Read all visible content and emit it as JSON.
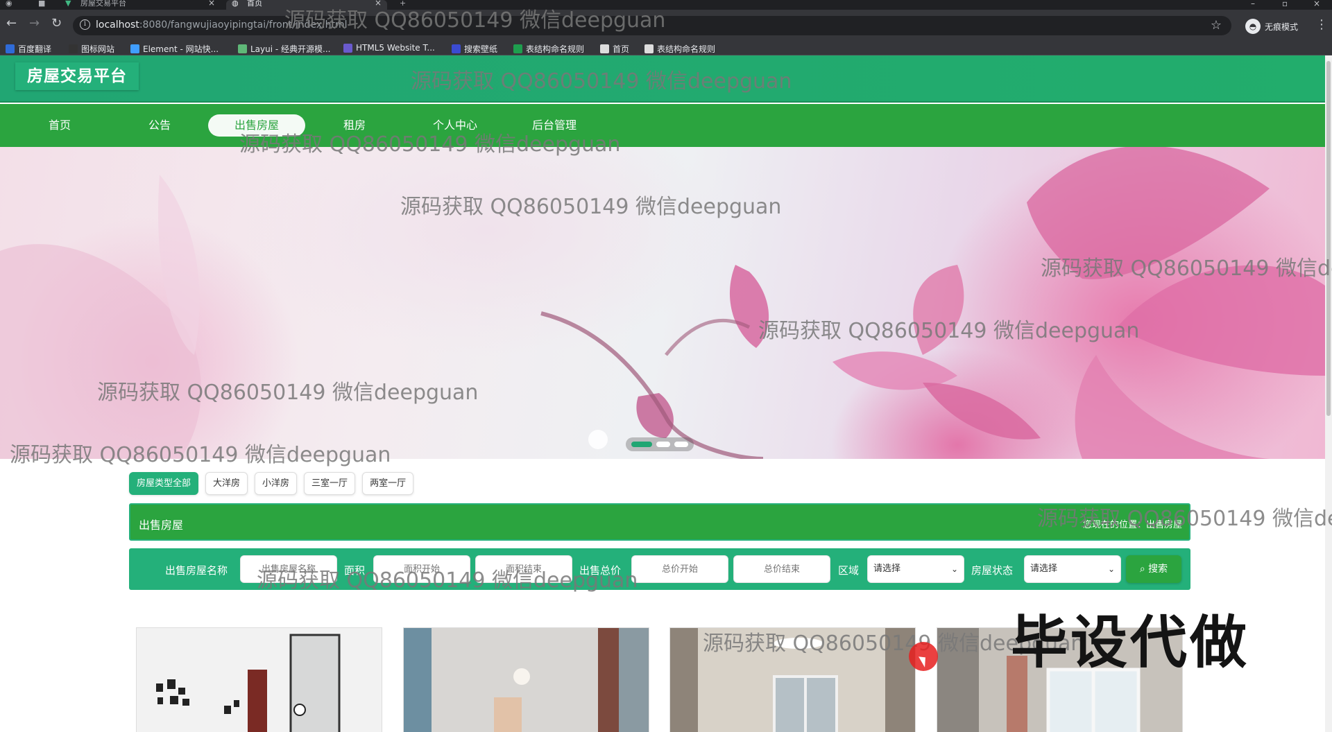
{
  "browser": {
    "tabs": [
      {
        "label": "房屋交易平台"
      },
      {
        "label": "首页"
      }
    ],
    "new_tab_glyph": "+",
    "address": {
      "host": "localhost",
      "path": ":8080/fangwujiaoyipingtai/front/index.html"
    },
    "incognito_label": "无痕模式",
    "bookmarks": [
      {
        "label": "百度翻译",
        "icon": "translate-icon",
        "color": "#2f6bd8"
      },
      {
        "label": "图标网站",
        "icon": "flag-icon",
        "color": "#333333"
      },
      {
        "label": "Element - 网站快...",
        "icon": "element-icon",
        "color": "#409eff"
      },
      {
        "label": "Layui - 经典开源模...",
        "icon": "layui-icon",
        "color": "#5fb878"
      },
      {
        "label": "HTML5 Website T...",
        "icon": "html5-icon",
        "color": "#6a5acd"
      },
      {
        "label": "搜索壁纸",
        "icon": "wallpaper-icon",
        "color": "#3b4bd1"
      },
      {
        "label": "表结构命名规则",
        "icon": "sheet-icon",
        "color": "#1e9e4e"
      },
      {
        "label": "首页",
        "icon": "globe-icon",
        "color": "#dddddd"
      },
      {
        "label": "表结构命名规则",
        "icon": "globe-icon",
        "color": "#dddddd"
      }
    ]
  },
  "site": {
    "logo": "房屋交易平台",
    "nav": [
      {
        "label": "首页"
      },
      {
        "label": "公告"
      },
      {
        "label": "出售房屋",
        "active": true
      },
      {
        "label": "租房"
      },
      {
        "label": "个人中心"
      },
      {
        "label": "后台管理"
      }
    ],
    "banner": {
      "slides": 3,
      "active_slide": 1
    },
    "type_filter": [
      "房屋类型全部",
      "大洋房",
      "小洋房",
      "三室一厅",
      "两室一厅"
    ],
    "section": {
      "title": "出售房屋",
      "breadcrumb": "您现在的位置：出售房屋"
    },
    "search": {
      "name_label": "出售房屋名称",
      "name_placeholder": "出售房屋名称",
      "area_label": "面积",
      "area_start_placeholder": "面积开始",
      "area_end_placeholder": "面积结束",
      "price_label": "出售总价",
      "price_start_placeholder": "总价开始",
      "price_end_placeholder": "总价结束",
      "region_label": "区域",
      "region_value": "请选择",
      "status_label": "房屋状态",
      "status_value": "请选择",
      "button_label": "搜索"
    }
  },
  "overlays": {
    "watermark": "源码获取 QQ86050149 微信deepguan",
    "promo": "毕设代做"
  },
  "colors": {
    "header_green": "#21a673",
    "nav_green": "#2ba43f",
    "accent": "#24b07a"
  }
}
